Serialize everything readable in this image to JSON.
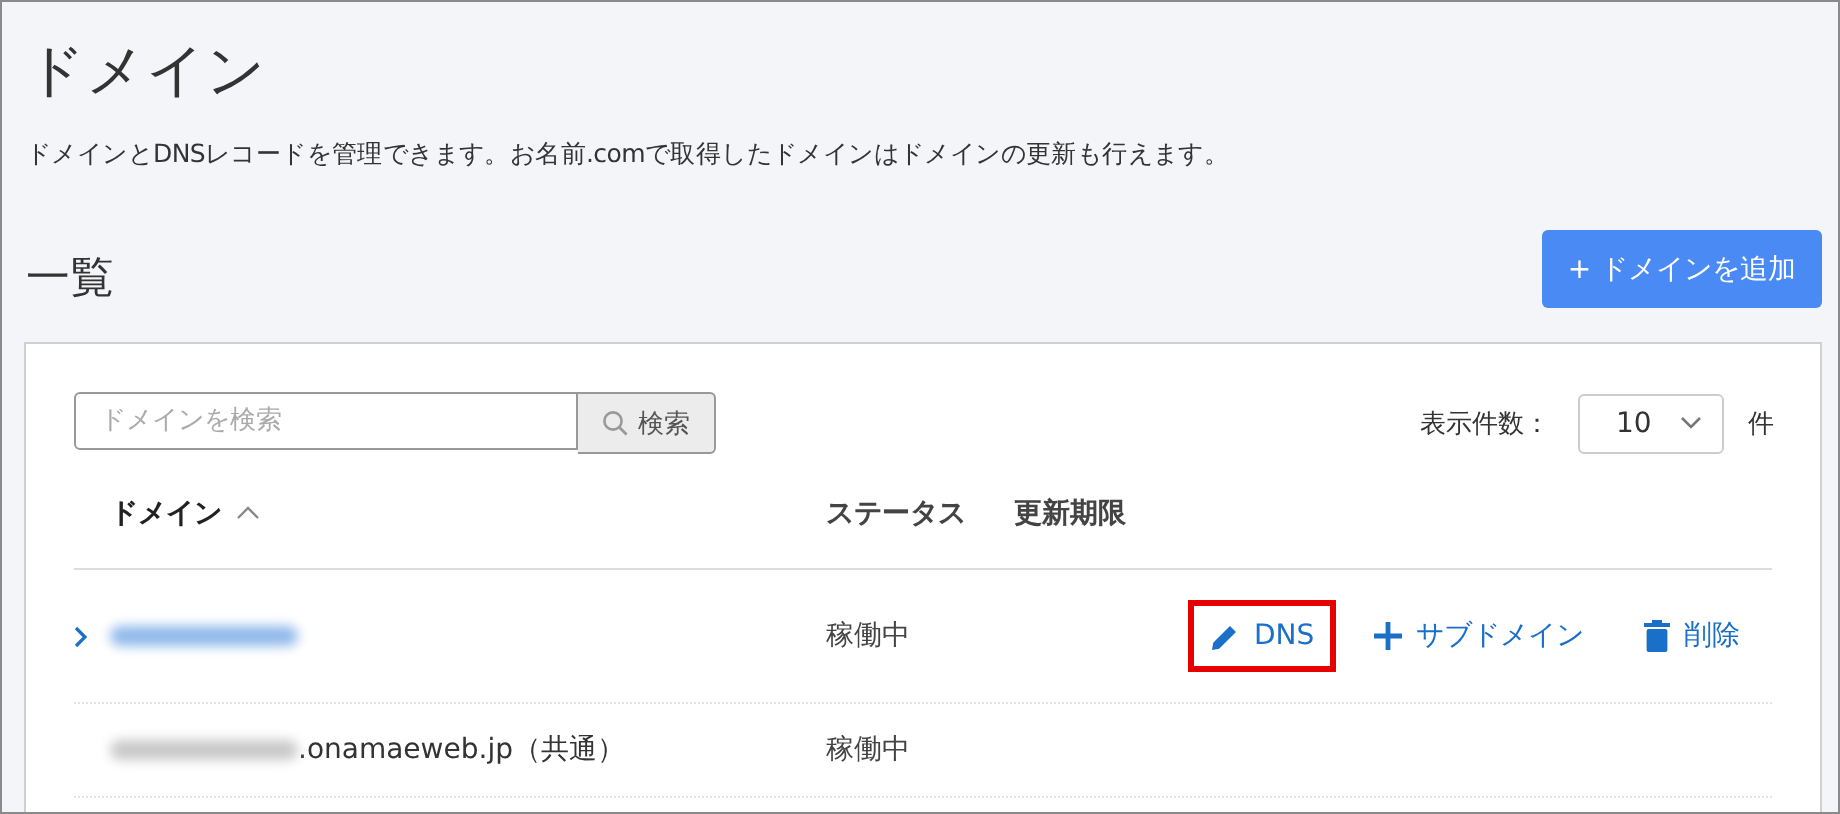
{
  "page": {
    "title": "ドメイン",
    "description": "ドメインとDNSレコードを管理できます。お名前.comで取得したドメインはドメインの更新も行えます。"
  },
  "list": {
    "heading": "一覧",
    "add_button": "+ ドメインを追加"
  },
  "search": {
    "placeholder": "ドメインを検索",
    "button": "検索"
  },
  "page_size": {
    "label": "表示件数：",
    "value": "10",
    "unit": "件"
  },
  "table": {
    "columns": [
      {
        "label": "ドメイン",
        "sort_ascending": true
      },
      {
        "label": "ステータス"
      },
      {
        "label": "更新期限"
      }
    ],
    "rows": [
      {
        "expandable": true,
        "redacted": true,
        "status": "稼働中",
        "actions": [
          {
            "kind": "edit",
            "label": "DNS",
            "highlighted": true
          },
          {
            "kind": "add",
            "label": "サブドメイン",
            "highlighted": false
          },
          {
            "kind": "delete",
            "label": "削除",
            "highlighted": false
          }
        ]
      },
      {
        "expandable": false,
        "redacted": true,
        "domain_suffix": ".onamaeweb.jp（共通）",
        "status": "稼働中",
        "actions": []
      }
    ]
  }
}
